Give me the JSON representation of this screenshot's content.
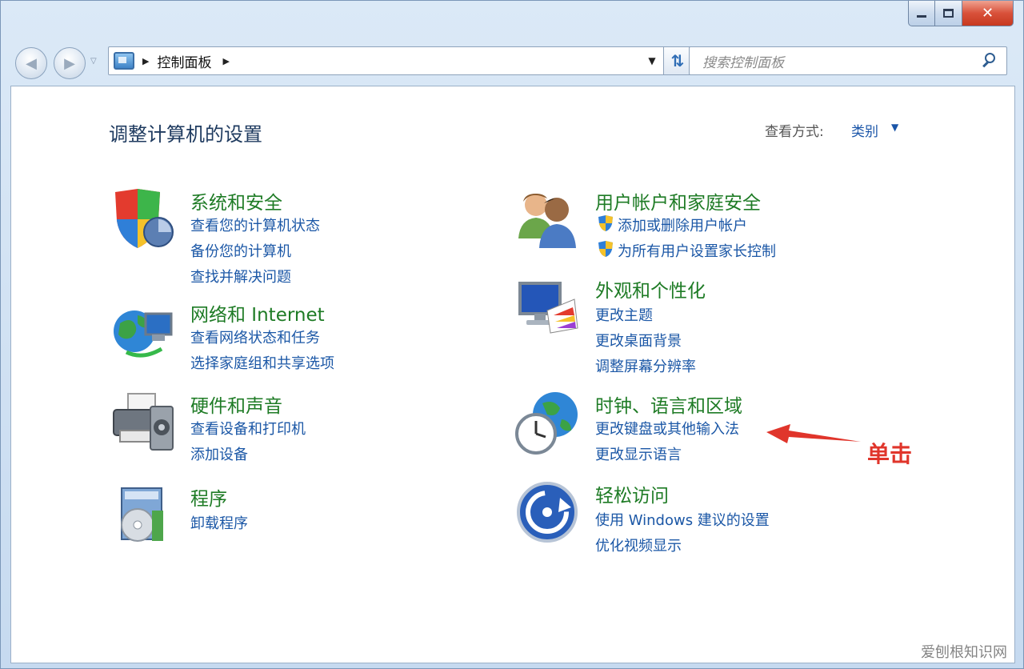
{
  "window": {
    "caption": {
      "minimize": "",
      "maximize": "",
      "close": "✕"
    }
  },
  "nav": {
    "breadcrumb": "控制面板",
    "search_placeholder": "搜索控制面板"
  },
  "page": {
    "title": "调整计算机的设置",
    "view_by_label": "查看方式:",
    "view_by_value": "类别"
  },
  "categories": [
    {
      "icon": "security-shield-icon",
      "title": "系统和安全",
      "links": [
        "查看您的计算机状态",
        "备份您的计算机",
        "查找并解决问题"
      ]
    },
    {
      "icon": "network-globe-icon",
      "title": "网络和 Internet",
      "links": [
        "查看网络状态和任务",
        "选择家庭组和共享选项"
      ]
    },
    {
      "icon": "printer-icon",
      "title": "硬件和声音",
      "links": [
        "查看设备和打印机",
        "添加设备"
      ]
    },
    {
      "icon": "programs-box-icon",
      "title": "程序",
      "links": [
        "卸载程序"
      ]
    },
    {
      "icon": "users-icon",
      "title": "用户帐户和家庭安全",
      "links": [
        "添加或删除用户帐户",
        "为所有用户设置家长控制"
      ]
    },
    {
      "icon": "monitor-paint-icon",
      "title": "外观和个性化",
      "links": [
        "更改主题",
        "更改桌面背景",
        "调整屏幕分辨率"
      ]
    },
    {
      "icon": "clock-globe-icon",
      "title": "时钟、语言和区域",
      "links": [
        "更改键盘或其他输入法",
        "更改显示语言"
      ]
    },
    {
      "icon": "ease-of-access-icon",
      "title": "轻松访问",
      "links": [
        "使用 Windows 建议的设置",
        "优化视频显示"
      ]
    }
  ],
  "annotation": {
    "text": "单击",
    "color": "#e0352b"
  },
  "watermark": "爱刨根知识网",
  "colors": {
    "category_title": "#1e7b25",
    "link": "#1b57a6",
    "title": "#1e3a5f"
  }
}
